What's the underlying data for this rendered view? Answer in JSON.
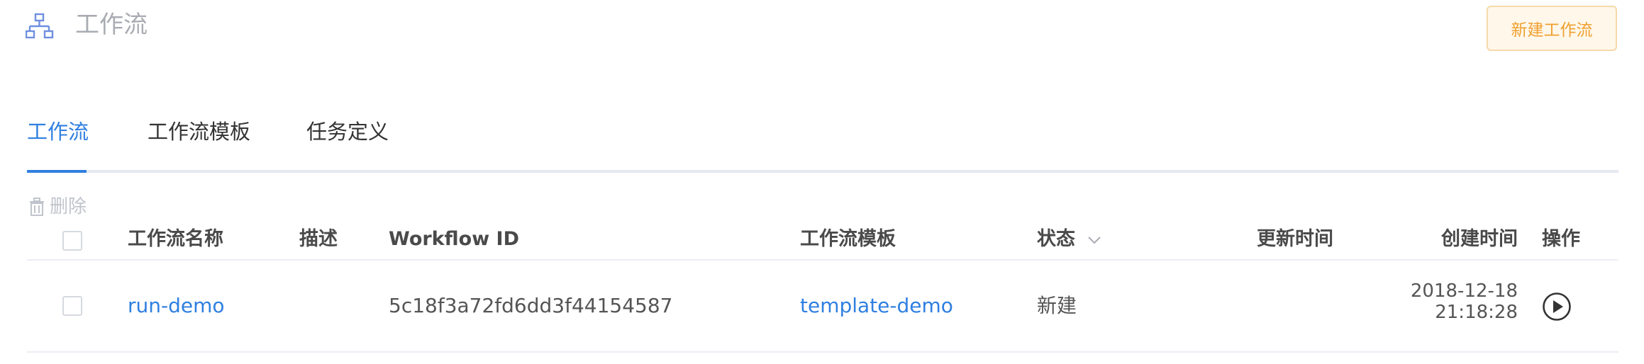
{
  "header": {
    "title": "工作流",
    "title_icon": "workflow-icon",
    "new_button_label": "新建工作流"
  },
  "tabs": [
    {
      "label": "工作流",
      "active": true
    },
    {
      "label": "工作流模板",
      "active": false
    },
    {
      "label": "任务定义",
      "active": false
    }
  ],
  "toolbar": {
    "delete_label": "删除",
    "delete_icon": "trash-icon"
  },
  "table": {
    "columns": {
      "name": "工作流名称",
      "description": "描述",
      "workflow_id": "Workflow ID",
      "template": "工作流模板",
      "status": "状态",
      "updated": "更新时间",
      "created": "创建时间",
      "actions": "操作"
    },
    "rows": [
      {
        "name": "run-demo",
        "description": "",
        "workflow_id": "5c18f3a72fd6dd3f44154587",
        "template": "template-demo",
        "status": "新建",
        "updated": "",
        "created_date": "2018-12-18",
        "created_time": "21:18:28",
        "action_icon": "play-icon"
      }
    ]
  },
  "colors": {
    "accent": "#2f7fe0",
    "warning_text": "#f0a030",
    "warning_bg": "#fff7ea",
    "muted": "#a9acb3"
  }
}
